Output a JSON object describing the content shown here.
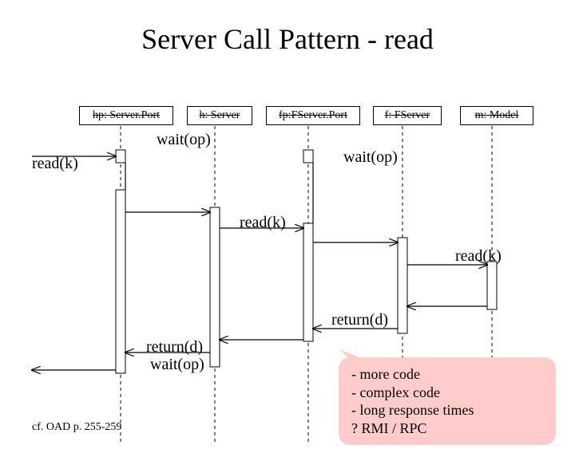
{
  "title": "Server Call Pattern - read",
  "objects": {
    "hp": "hp: Server.Port",
    "h": "h: Server",
    "fp": "fp:FServer.Port",
    "f": "f: FServer",
    "m": "m: Model"
  },
  "messages": {
    "read_k_1": "read(k)",
    "wait_op_1": "wait(op)",
    "wait_op_2": "wait(op)",
    "read_k_2": "read(k)",
    "read_k_3": "read(k)",
    "return_d_1": "return(d)",
    "return_d_2": "return(d)",
    "wait_op_3": "wait(op)"
  },
  "callout": {
    "line1": "- more code",
    "line2": "- complex code",
    "line3": "- long response times",
    "line4": "? RMI / RPC"
  },
  "footer": "cf.  OAD p. 255-259"
}
